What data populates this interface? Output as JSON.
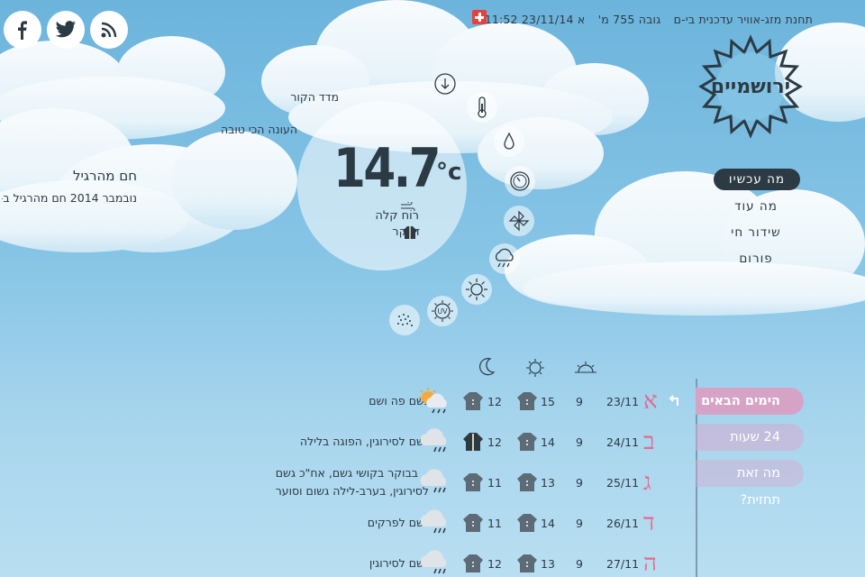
{
  "header": {
    "station_name": "תחנת מזג-אוויר עדכנית בי-ם",
    "altitude": "גובה 755 מ'",
    "datetime": "א 23/11/14 11:52"
  },
  "social": [
    {
      "name": "facebook-icon"
    },
    {
      "name": "twitter-icon"
    },
    {
      "name": "rss-icon"
    }
  ],
  "logo": {
    "text": "ירושמיים"
  },
  "menu": {
    "items": [
      "מה עכשיו",
      "מה עוד",
      "שידור חי",
      "פורום"
    ],
    "active": 0
  },
  "current": {
    "temperature": "14.7",
    "unit": "c",
    "wind_desc": "רוח קלה",
    "dry_desc": "די קר",
    "feels_label": "מדד הקור",
    "best_season": "העונה הכי טובה"
  },
  "holiday": {
    "title": "חם מהרגיל",
    "subtitle": "נובמבר 2014 חם מהרגיל ב-"
  },
  "forecast_icons": [
    "arrow-down-icon",
    "thermometer-icon",
    "drop-icon",
    "clock-icon",
    "wind-icon",
    "cloud-rain-icon",
    "sun-icon",
    "uv-icon",
    "dust-icon"
  ],
  "forecast": {
    "tabs": [
      "הימים הבאים",
      "24 שעות",
      "מה זאת תחזית?"
    ],
    "rows": [
      {
        "letter": "א",
        "date": "23/11",
        "wind": "9",
        "max": "15",
        "min": "12",
        "desc": [
          "גשם פה ושם"
        ],
        "icon": "sun-cloud-rain-icon",
        "cloth": "sweater-icon"
      },
      {
        "letter": "ב",
        "date": "24/11",
        "wind": "9",
        "max": "14",
        "min": "12",
        "desc": [
          "גשם לסירוגין, הפוגה בלילה"
        ],
        "icon": "cloud-rain-icon",
        "cloth": "coat-icon"
      },
      {
        "letter": "ג",
        "date": "25/11",
        "wind": "9",
        "max": "13",
        "min": "11",
        "desc": [
          "בבוקר בקושי גשם, אח\"כ גשם",
          "לסירוגין, בערב-לילה גשום וסוער"
        ],
        "icon": "cloud-rain-icon",
        "cloth": "sweater-icon"
      },
      {
        "letter": "ד",
        "date": "26/11",
        "wind": "9",
        "max": "14",
        "min": "11",
        "desc": [
          "גשם לפרקים"
        ],
        "icon": "cloud-rain-icon",
        "cloth": "sweater-icon"
      },
      {
        "letter": "ה",
        "date": "27/11",
        "wind": "9",
        "max": "13",
        "min": "12",
        "desc": [
          "גשם לסירוגין"
        ],
        "icon": "cloud-rain-icon",
        "cloth": "sweater-icon"
      }
    ]
  },
  "colors": {
    "accent": "#e46a8e",
    "text": "#2c3a44",
    "tab": "#d6a3c6"
  }
}
